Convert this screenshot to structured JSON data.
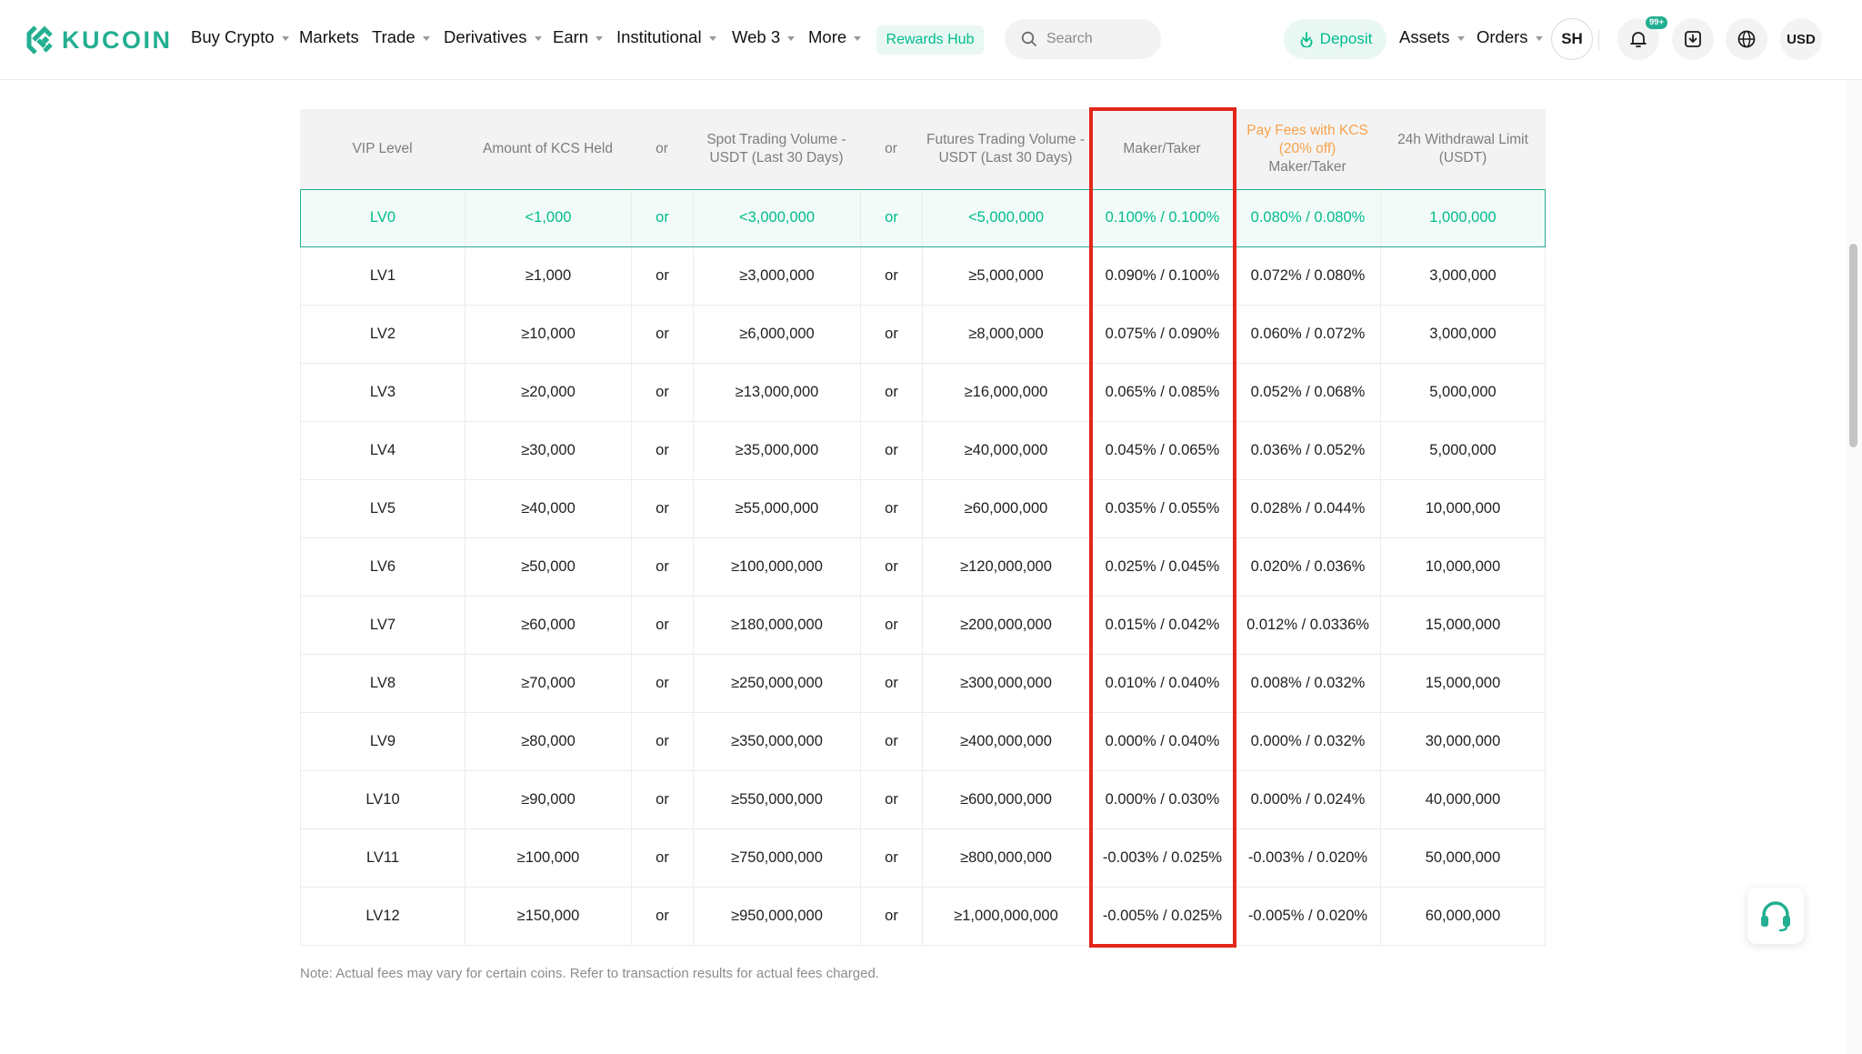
{
  "header": {
    "logo_text": "KUCOIN",
    "nav": [
      {
        "label": "Buy Crypto",
        "dropdown": true
      },
      {
        "label": "Markets",
        "dropdown": false
      },
      {
        "label": "Trade",
        "dropdown": true
      },
      {
        "label": "Derivatives",
        "dropdown": true
      },
      {
        "label": "Earn",
        "dropdown": true
      },
      {
        "label": "Institutional",
        "dropdown": true
      },
      {
        "label": "Web 3",
        "dropdown": true
      },
      {
        "label": "More",
        "dropdown": true
      }
    ],
    "rewards_hub": "Rewards Hub",
    "search_placeholder": "Search",
    "deposit": "Deposit",
    "assets": "Assets",
    "orders": "Orders",
    "avatar": "SH",
    "notification_badge": "99+",
    "currency": "USD"
  },
  "table": {
    "headers": {
      "vip_level": "VIP Level",
      "kcs_held": "Amount of KCS Held",
      "or1": "or",
      "spot_volume_line1": "Spot Trading Volume -",
      "spot_volume_line2": "USDT (Last 30 Days)",
      "or2": "or",
      "futures_volume_line1": "Futures Trading Volume -",
      "futures_volume_line2": "USDT (Last 30 Days)",
      "maker_taker": "Maker/Taker",
      "kcs_fees_line1": "Pay Fees with KCS",
      "kcs_fees_line2": "(20% off)",
      "kcs_fees_line3": "Maker/Taker",
      "withdrawal_line1": "24h Withdrawal Limit",
      "withdrawal_line2": "(USDT)"
    },
    "rows": [
      {
        "level": "LV0",
        "kcs": "<1,000",
        "or1": "or",
        "spot": "<3,000,000",
        "or2": "or",
        "futures": "<5,000,000",
        "maker_taker": "0.100% / 0.100%",
        "kcs_fee": "0.080% / 0.080%",
        "withdrawal": "1,000,000"
      },
      {
        "level": "LV1",
        "kcs": "≥1,000",
        "or1": "or",
        "spot": "≥3,000,000",
        "or2": "or",
        "futures": "≥5,000,000",
        "maker_taker": "0.090% / 0.100%",
        "kcs_fee": "0.072% / 0.080%",
        "withdrawal": "3,000,000"
      },
      {
        "level": "LV2",
        "kcs": "≥10,000",
        "or1": "or",
        "spot": "≥6,000,000",
        "or2": "or",
        "futures": "≥8,000,000",
        "maker_taker": "0.075% / 0.090%",
        "kcs_fee": "0.060% / 0.072%",
        "withdrawal": "3,000,000"
      },
      {
        "level": "LV3",
        "kcs": "≥20,000",
        "or1": "or",
        "spot": "≥13,000,000",
        "or2": "or",
        "futures": "≥16,000,000",
        "maker_taker": "0.065% / 0.085%",
        "kcs_fee": "0.052% / 0.068%",
        "withdrawal": "5,000,000"
      },
      {
        "level": "LV4",
        "kcs": "≥30,000",
        "or1": "or",
        "spot": "≥35,000,000",
        "or2": "or",
        "futures": "≥40,000,000",
        "maker_taker": "0.045% / 0.065%",
        "kcs_fee": "0.036% / 0.052%",
        "withdrawal": "5,000,000"
      },
      {
        "level": "LV5",
        "kcs": "≥40,000",
        "or1": "or",
        "spot": "≥55,000,000",
        "or2": "or",
        "futures": "≥60,000,000",
        "maker_taker": "0.035% / 0.055%",
        "kcs_fee": "0.028% / 0.044%",
        "withdrawal": "10,000,000"
      },
      {
        "level": "LV6",
        "kcs": "≥50,000",
        "or1": "or",
        "spot": "≥100,000,000",
        "or2": "or",
        "futures": "≥120,000,000",
        "maker_taker": "0.025% / 0.045%",
        "kcs_fee": "0.020% / 0.036%",
        "withdrawal": "10,000,000"
      },
      {
        "level": "LV7",
        "kcs": "≥60,000",
        "or1": "or",
        "spot": "≥180,000,000",
        "or2": "or",
        "futures": "≥200,000,000",
        "maker_taker": "0.015% / 0.042%",
        "kcs_fee": "0.012% / 0.0336%",
        "withdrawal": "15,000,000"
      },
      {
        "level": "LV8",
        "kcs": "≥70,000",
        "or1": "or",
        "spot": "≥250,000,000",
        "or2": "or",
        "futures": "≥300,000,000",
        "maker_taker": "0.010% / 0.040%",
        "kcs_fee": "0.008% / 0.032%",
        "withdrawal": "15,000,000"
      },
      {
        "level": "LV9",
        "kcs": "≥80,000",
        "or1": "or",
        "spot": "≥350,000,000",
        "or2": "or",
        "futures": "≥400,000,000",
        "maker_taker": "0.000% / 0.040%",
        "kcs_fee": "0.000% / 0.032%",
        "withdrawal": "30,000,000"
      },
      {
        "level": "LV10",
        "kcs": "≥90,000",
        "or1": "or",
        "spot": "≥550,000,000",
        "or2": "or",
        "futures": "≥600,000,000",
        "maker_taker": "0.000% / 0.030%",
        "kcs_fee": "0.000% / 0.024%",
        "withdrawal": "40,000,000"
      },
      {
        "level": "LV11",
        "kcs": "≥100,000",
        "or1": "or",
        "spot": "≥750,000,000",
        "or2": "or",
        "futures": "≥800,000,000",
        "maker_taker": "-0.003% / 0.025%",
        "kcs_fee": "-0.003% / 0.020%",
        "withdrawal": "50,000,000"
      },
      {
        "level": "LV12",
        "kcs": "≥150,000",
        "or1": "or",
        "spot": "≥950,000,000",
        "or2": "or",
        "futures": "≥1,000,000,000",
        "maker_taker": "-0.005% / 0.025%",
        "kcs_fee": "-0.005% / 0.020%",
        "withdrawal": "60,000,000"
      }
    ]
  },
  "note": "Note: Actual fees may vary for certain coins. Refer to transaction results for actual fees charged.",
  "colors": {
    "brand_green": "#23af91",
    "highlight_red": "#e3261b",
    "kcs_orange": "#f7a24b"
  }
}
